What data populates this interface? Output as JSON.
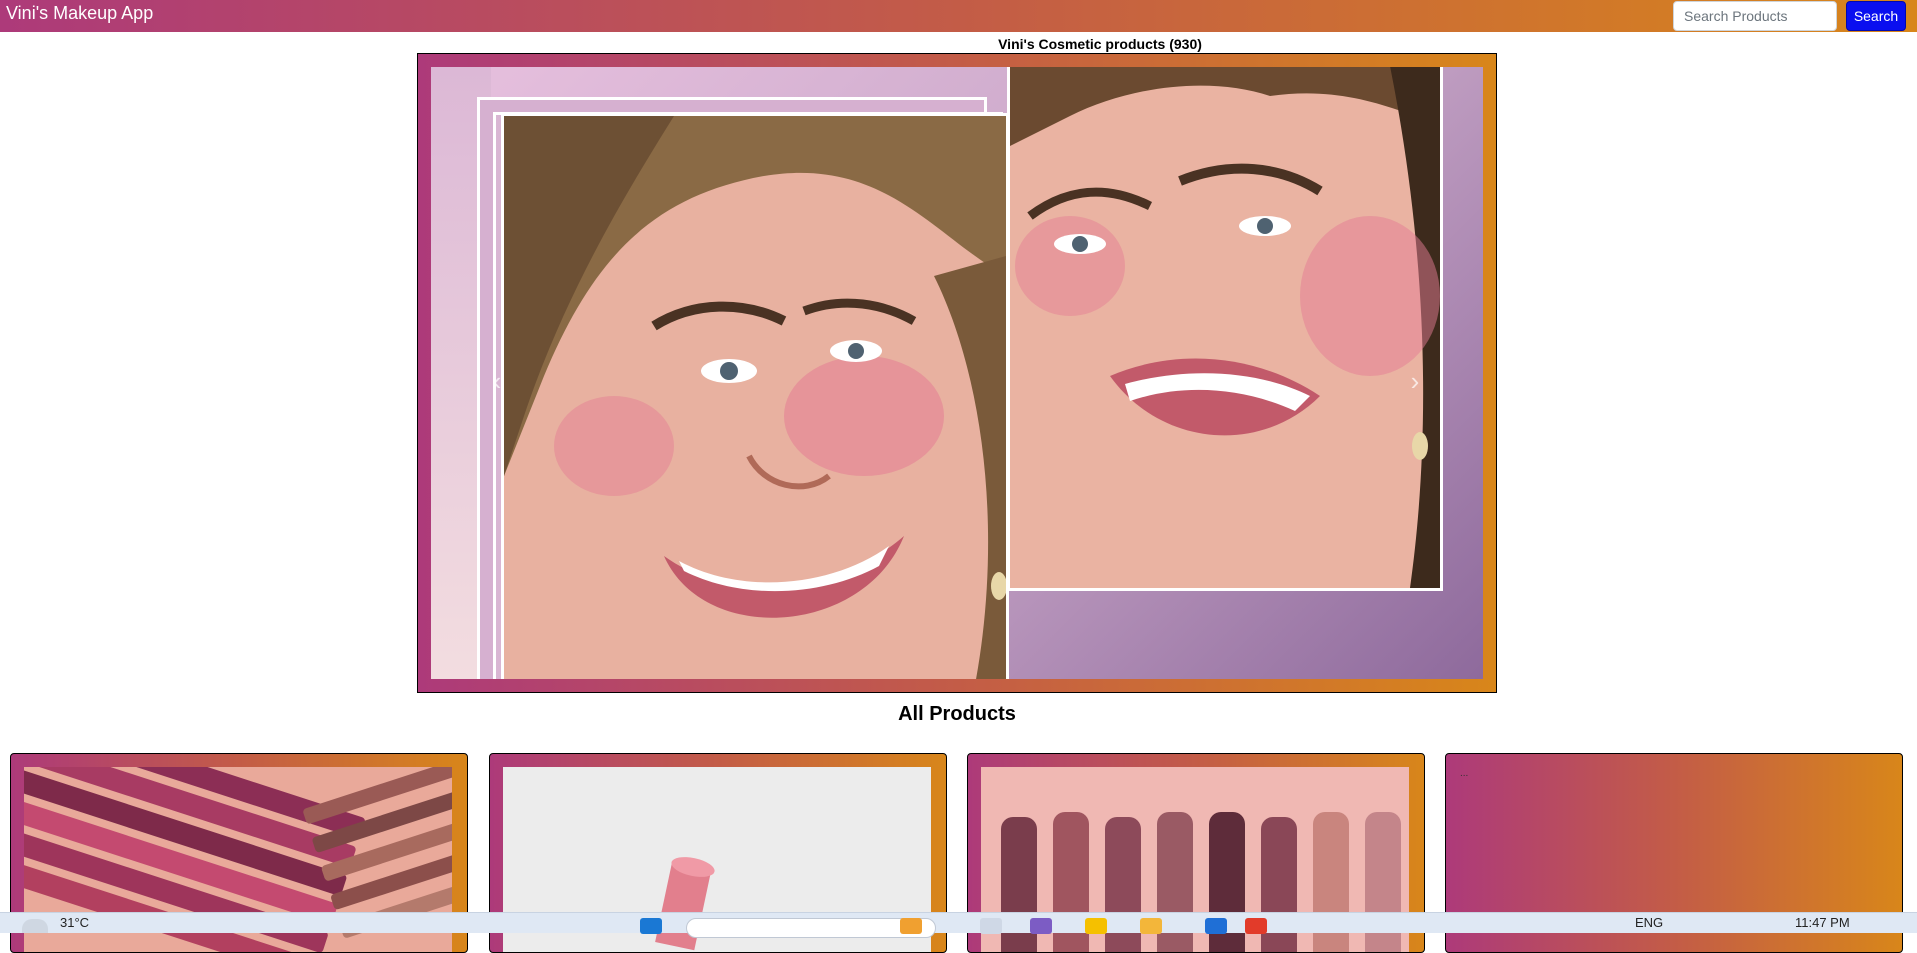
{
  "navbar": {
    "brand": "Vini's Makeup App",
    "search_placeholder": "Search Products",
    "search_button": "Search"
  },
  "page_title": "Vini's Cosmetic products (930)",
  "carousel": {
    "prev": "‹",
    "next": "›"
  },
  "section_heading": "All Products",
  "product_cards": [
    {
      "image": "lippie-pencil-photo"
    },
    {
      "image": "pink-lipstick-photo"
    },
    {
      "image": "lipstick-lineup-photo"
    },
    {
      "text": "..."
    }
  ],
  "taskbar": {
    "temperature": "31°C",
    "language": "ENG",
    "time": "11:47 PM"
  },
  "colors": {
    "gradient_start": "#ad3a7a",
    "gradient_end": "#d8861a",
    "search_button": "#0a0ff0"
  }
}
